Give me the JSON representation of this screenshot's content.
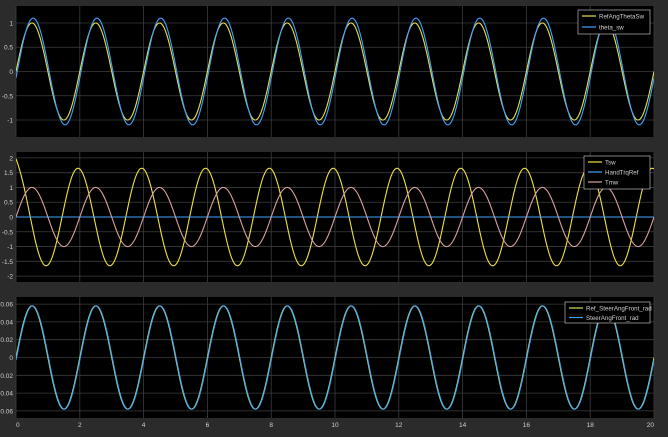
{
  "theme": {
    "background": "#2b2b2b",
    "axes_background": "#000000",
    "grid_color": "#3c3c3c",
    "tick_color": "#d0d0d0",
    "legend_background": "#000000",
    "legend_border": "#d8d8d8"
  },
  "chart_data": [
    {
      "type": "line",
      "ylim": [
        -1.35,
        1.35
      ],
      "yticks": [
        1,
        0.5,
        0,
        -0.5,
        -1
      ],
      "ytick_labels": [
        "1",
        "0.5",
        "0",
        "-0.5",
        "-1"
      ],
      "xlim": [
        0,
        20
      ],
      "grid": true,
      "legend_position": "top-right",
      "series": [
        {
          "name": "RefAngThetaSw",
          "color": "#e8e04a",
          "amplitude": 1.0,
          "frequency": 0.5,
          "phase": 0
        },
        {
          "name": "theta_sw",
          "color": "#3fa4ff",
          "amplitude": 1.1,
          "frequency": 0.5,
          "phase": -0.12
        }
      ]
    },
    {
      "type": "line",
      "ylim": [
        -2.2,
        2.2
      ],
      "yticks": [
        2,
        1.5,
        1,
        0.5,
        0,
        -0.5,
        -1,
        -1.5,
        -2
      ],
      "ytick_labels": [
        "2",
        "1.5",
        "1",
        "0.5",
        "0",
        "-0.5",
        "-1",
        "-1.5",
        "-2"
      ],
      "xlim": [
        0,
        20
      ],
      "grid": true,
      "legend_position": "top-right",
      "series": [
        {
          "name": "Tsw",
          "color": "#f0e23c",
          "amplitude": 1.65,
          "frequency": 0.5,
          "phase": 1.75
        },
        {
          "name": "HandTrqRef",
          "color": "#3fa4ff",
          "amplitude": 0,
          "frequency": 0.5,
          "phase": 0
        },
        {
          "name": "Tmw",
          "color": "#d9a0a0",
          "amplitude": 1.0,
          "frequency": 0.5,
          "phase": 0
        }
      ]
    },
    {
      "type": "line",
      "ylim": [
        -0.068,
        0.068
      ],
      "yticks": [
        0.06,
        0.04,
        0.02,
        0,
        -0.02,
        -0.04,
        -0.06
      ],
      "ytick_labels": [
        "0.06",
        "0.04",
        "0.02",
        "0",
        "-0.02",
        "-0.04",
        "-0.06"
      ],
      "xlim": [
        0,
        20
      ],
      "xticks": [
        0,
        2,
        4,
        6,
        8,
        10,
        12,
        14,
        16,
        18,
        20
      ],
      "xtick_labels": [
        "0",
        "2",
        "4",
        "6",
        "8",
        "10",
        "12",
        "14",
        "16",
        "18",
        "20"
      ],
      "grid": true,
      "legend_position": "top-right",
      "series": [
        {
          "name": "Ref_SteerAngFront_rad",
          "color": "#c9e060",
          "amplitude": 0.058,
          "frequency": 0.5,
          "phase": 0
        },
        {
          "name": "SteerAngFront_rad",
          "color": "#3fa4ff",
          "amplitude": 0.058,
          "frequency": 0.5,
          "phase": -0.05
        }
      ]
    }
  ]
}
